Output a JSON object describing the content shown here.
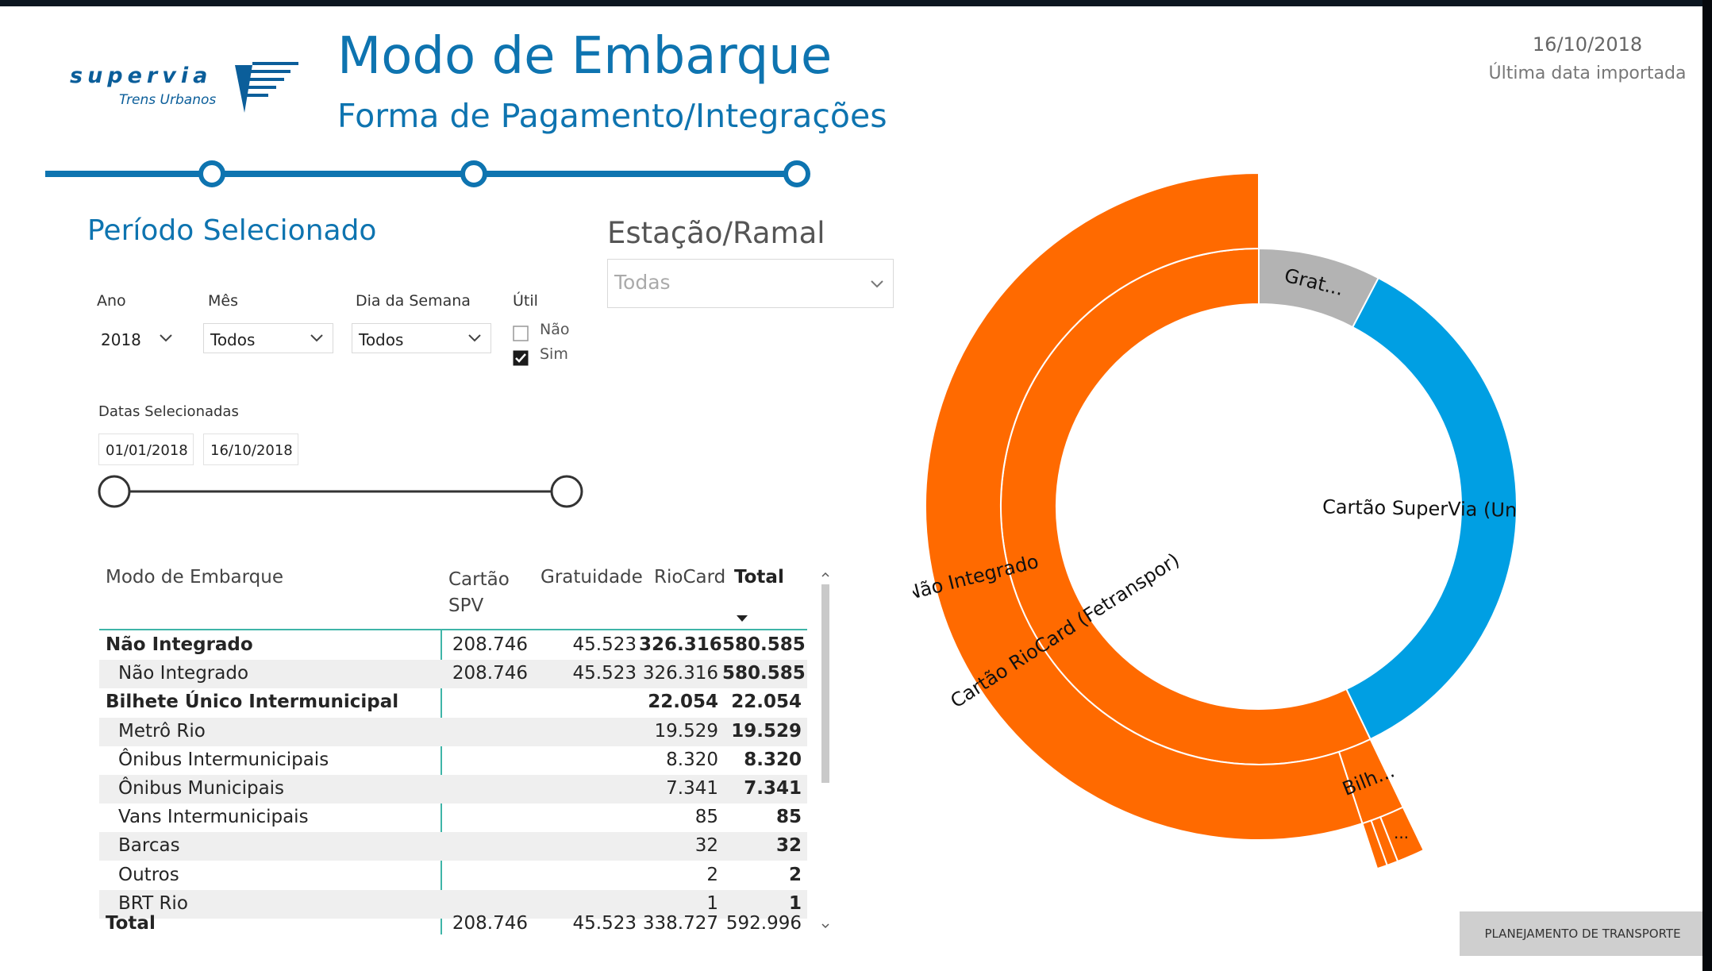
{
  "header": {
    "logo_brand": "supervia",
    "logo_sub": "Trens Urbanos",
    "title": "Modo de Embarque",
    "subtitle": "Forma de Pagamento/Integrações",
    "date": "16/10/2018",
    "date_caption": "Última data importada"
  },
  "filters": {
    "period_title": "Período Selecionado",
    "station_title": "Estação/Ramal",
    "station_value": "Todas",
    "ano_label": "Ano",
    "ano_value": "2018",
    "mes_label": "Mês",
    "mes_value": "Todos",
    "dia_label": "Dia da Semana",
    "dia_value": "Todos",
    "util_label": "Útil",
    "util_options": [
      {
        "label": "Não",
        "checked": false
      },
      {
        "label": "Sim",
        "checked": true
      }
    ],
    "datas_label": "Datas Selecionadas",
    "date_start": "01/01/2018",
    "date_end": "16/10/2018"
  },
  "table": {
    "columns": [
      "Modo de Embarque",
      "Cartão SPV",
      "Gratuidade",
      "RioCard",
      "Total"
    ],
    "rows": [
      {
        "name": "Não Integrado",
        "level": 0,
        "spv": "208.746",
        "grat": "45.523",
        "rio": "326.316",
        "total": "580.585"
      },
      {
        "name": "Não Integrado",
        "level": 1,
        "spv": "208.746",
        "grat": "45.523",
        "rio": "326.316",
        "total": "580.585"
      },
      {
        "name": "Bilhete Único Intermunicipal",
        "level": 0,
        "spv": "",
        "grat": "",
        "rio": "22.054",
        "total": "22.054"
      },
      {
        "name": "Metrô Rio",
        "level": 1,
        "spv": "",
        "grat": "",
        "rio": "19.529",
        "total": "19.529"
      },
      {
        "name": "Ônibus Intermunicipais",
        "level": 1,
        "spv": "",
        "grat": "",
        "rio": "8.320",
        "total": "8.320"
      },
      {
        "name": "Ônibus Municipais",
        "level": 1,
        "spv": "",
        "grat": "",
        "rio": "7.341",
        "total": "7.341"
      },
      {
        "name": "Vans Intermunicipais",
        "level": 1,
        "spv": "",
        "grat": "",
        "rio": "85",
        "total": "85"
      },
      {
        "name": "Barcas",
        "level": 1,
        "spv": "",
        "grat": "",
        "rio": "32",
        "total": "32"
      },
      {
        "name": "Outros",
        "level": 1,
        "spv": "",
        "grat": "",
        "rio": "2",
        "total": "2"
      },
      {
        "name": "BRT Rio",
        "level": 1,
        "spv": "",
        "grat": "",
        "rio": "1",
        "total": "1"
      }
    ],
    "totals": {
      "name": "Total",
      "spv": "208.746",
      "grat": "45.523",
      "rio": "338.727",
      "total": "592.996"
    }
  },
  "chart_data": {
    "type": "sunburst",
    "colors": {
      "riocard": "#ff6a00",
      "spv": "#009fe3",
      "grat": "#b3b3b3"
    },
    "inner_ring": [
      {
        "label": "Cartão RioCard (Fetranspor)",
        "value": 338727,
        "color": "#ff6a00"
      },
      {
        "label": "Grat...",
        "value": 45523,
        "color": "#b3b3b3"
      },
      {
        "label": "Cartão SuperVia (Unitário/Múltiplo)",
        "value": 208746,
        "color": "#009fe3"
      }
    ],
    "outer_ring": [
      {
        "label": "Não Integrado",
        "value": 326316,
        "color": "#ff6a00"
      },
      {
        "label": "Bilh...",
        "value": 12411,
        "color": "#ff6a00"
      }
    ],
    "third_ring": [
      {
        "label": "...",
        "value": 7000,
        "color": "#ff6a00"
      },
      {
        "label": "",
        "value": 2800,
        "color": "#ff6a00"
      },
      {
        "label": "",
        "value": 2611,
        "color": "#ff6a00"
      }
    ]
  },
  "footer": {
    "planning_button": "PLANEJAMENTO DE TRANSPORTE"
  }
}
